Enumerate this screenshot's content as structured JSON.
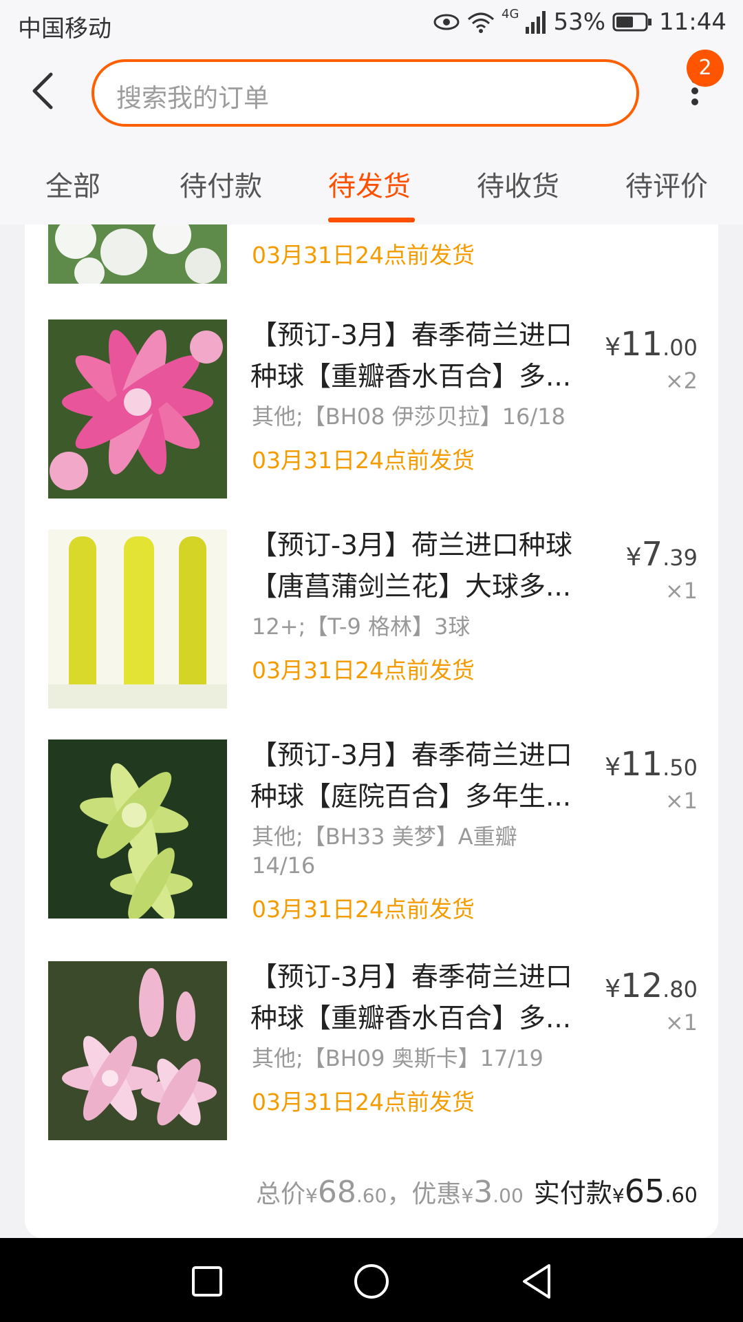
{
  "status": {
    "carrier": "中国移动",
    "network": "4G",
    "battery": "53%",
    "time": "11:44"
  },
  "search": {
    "placeholder": "搜索我的订单"
  },
  "badge_count": "2",
  "tabs": [
    {
      "label": "全部"
    },
    {
      "label": "待付款"
    },
    {
      "label": "待发货"
    },
    {
      "label": "待收货"
    },
    {
      "label": "待评价"
    }
  ],
  "active_tab": "待发货",
  "first_item_ship": "03月31日24点前发货",
  "items": [
    {
      "title1": "【预订-3月】春季荷兰进口",
      "title2": "种球【重瓣香水百合】多...",
      "sku": "其他;【BH08 伊莎贝拉】16/18",
      "ship": "03月31日24点前发货",
      "currency": "¥",
      "price_int": "11",
      "price_dec": ".00",
      "qty": "×2"
    },
    {
      "title1": "【预订-3月】荷兰进口种球",
      "title2": "【唐菖蒲剑兰花】大球多...",
      "sku": "12+;【T-9 格林】3球",
      "ship": "03月31日24点前发货",
      "currency": "¥",
      "price_int": "7",
      "price_dec": ".39",
      "qty": "×1"
    },
    {
      "title1": "【预订-3月】春季荷兰进口",
      "title2": "种球【庭院百合】多年生...",
      "sku": "其他;【BH33 美梦】A重瓣 14/16",
      "ship": "03月31日24点前发货",
      "currency": "¥",
      "price_int": "11",
      "price_dec": ".50",
      "qty": "×1"
    },
    {
      "title1": "【预订-3月】春季荷兰进口",
      "title2": "种球【重瓣香水百合】多...",
      "sku": "其他;【BH09 奥斯卡】17/19",
      "ship": "03月31日24点前发货",
      "currency": "¥",
      "price_int": "12",
      "price_dec": ".80",
      "qty": "×1"
    }
  ],
  "summary": {
    "total_label": "总价",
    "currency": "¥",
    "total_int": "68",
    "total_dec": ".60",
    "sep": "，",
    "discount_label": "优惠",
    "discount_int": "3",
    "discount_dec": ".00",
    "paid_label": "实付款",
    "paid_int": "65",
    "paid_dec": ".60"
  },
  "colors": {
    "accent": "#ff5000",
    "ship_text": "#f49b00"
  }
}
